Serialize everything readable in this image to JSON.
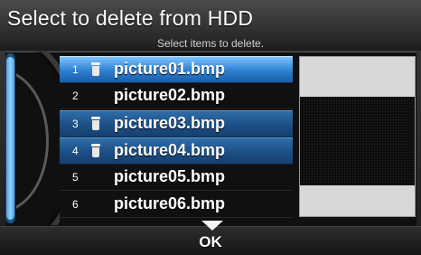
{
  "header": {
    "title": "Select to delete from HDD",
    "subtitle": "Select items to delete."
  },
  "list": {
    "items": [
      {
        "number": "1",
        "name": "picture01.bmp",
        "marked": true,
        "focused": true
      },
      {
        "number": "2",
        "name": "picture02.bmp",
        "marked": false,
        "focused": false
      },
      {
        "number": "3",
        "name": "picture03.bmp",
        "marked": true,
        "focused": false
      },
      {
        "number": "4",
        "name": "picture04.bmp",
        "marked": true,
        "focused": false
      },
      {
        "number": "5",
        "name": "picture05.bmp",
        "marked": false,
        "focused": false
      },
      {
        "number": "6",
        "name": "picture06.bmp",
        "marked": false,
        "focused": false
      }
    ]
  },
  "footer": {
    "ok_label": "OK"
  },
  "colors": {
    "selected_row": "#1c4f86",
    "focused_row": "#2d7fd0",
    "scrollbar": "#4fa3dc"
  },
  "icons": {
    "marked_icon": "trash-icon",
    "ok_icon": "down-arrow-icon"
  }
}
